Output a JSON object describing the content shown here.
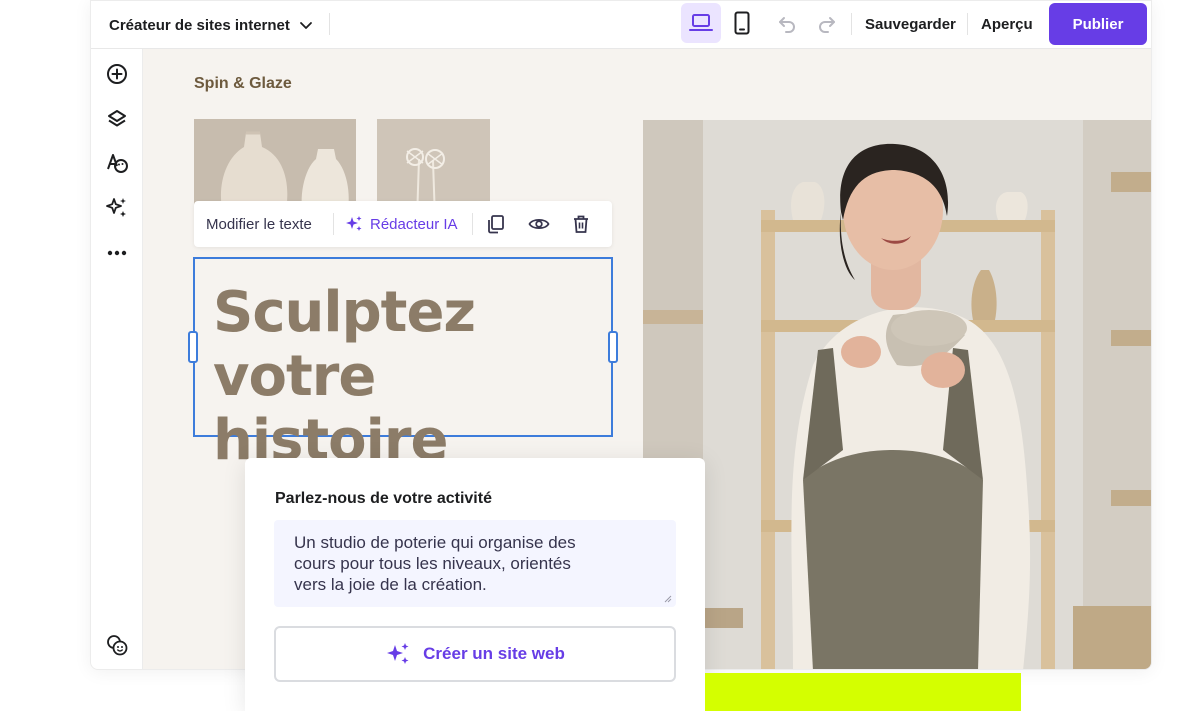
{
  "topbar": {
    "title": "Créateur de sites internet",
    "save_label": "Sauvegarder",
    "preview_label": "Aperçu",
    "publish_label": "Publier"
  },
  "site": {
    "brand": "Spin & Glaze",
    "headline_line1": "Sculptez",
    "headline_line2": "votre histoire"
  },
  "editbar": {
    "edit_text": "Modifier le texte",
    "ai_writer": "Rédacteur IA"
  },
  "panel": {
    "label": "Parlez-nous de votre activité",
    "description_line1": "Un studio de poterie qui organise des",
    "description_line2": "cours pour tous les niveaux, orientés",
    "description_line3": "vers la joie de la création.",
    "create_button": "Créer un site web"
  },
  "colors": {
    "accent": "#673de6",
    "accent_light": "#ebe4ff",
    "selection": "#3d7cdb",
    "headline": "#8c7c68",
    "brand_text": "#6d5a3e",
    "highlight_bar": "#d4ff00"
  },
  "icons": {
    "sidebar": [
      "add-circle-icon",
      "layers-icon",
      "typography-palette-icon",
      "ai-sparkle-icon",
      "more-dots-icon",
      "help-face-icon"
    ],
    "editbar": [
      "sparkle-icon",
      "duplicate-icon",
      "visibility-eye-icon",
      "trash-icon"
    ],
    "topbar": [
      "chevron-down-icon",
      "desktop-icon",
      "mobile-icon",
      "undo-icon",
      "redo-icon"
    ]
  }
}
